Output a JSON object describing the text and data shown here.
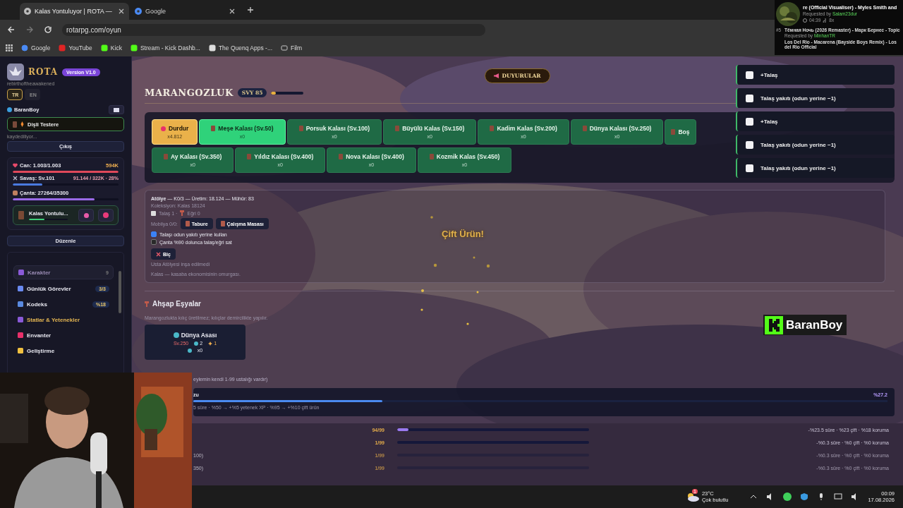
{
  "browser": {
    "tabs": [
      {
        "title": "Kalas Yontuluyor | ROTA —",
        "selected": true
      },
      {
        "title": "Google",
        "selected": false
      }
    ],
    "url": "rotarpg.com/oyun",
    "bookmarks": [
      "Google",
      "YouTube",
      "Kick",
      "Stream - Kick Dashb...",
      "The Quenq Apps -...",
      "Film"
    ]
  },
  "music_overlay": {
    "title": "re (Official Visualiser) - Myles Smith and",
    "requested_label": "Requested by",
    "requester": "Salam23dur",
    "duration": "04:39",
    "plays": "8x",
    "queue": [
      {
        "number": "#5",
        "title": "Тёмная Ночь (2026 Remaster) - Марк Бернес - Topic",
        "requested_label": "Requested by",
        "requester": "MinhanTR"
      },
      {
        "title": "Los Del Rio - Macarena (Bayside Boys Remix) - Los del Rio Official"
      }
    ]
  },
  "sidebar": {
    "logo": "ROTA",
    "version": "Version V1.0",
    "tagline": "rebirthoftheawakened",
    "languages": [
      {
        "label": "TR",
        "selected": true
      },
      {
        "label": "EN",
        "selected": false
      }
    ],
    "user": "BaranBoy",
    "equipped": "Dişli Testere",
    "save_status": "kaydediliyor...",
    "logout": "Çıkış",
    "stats": {
      "health": {
        "text": "Can: 1.003/1.003",
        "level": 1.0
      },
      "gold": "594K",
      "combat": {
        "text": "Savaş: Sv.101",
        "xp": "91.144 / 322K · 28%",
        "level": 0.28
      },
      "bag": {
        "text": "Çanta: 27264/35300",
        "level": 0.77
      }
    },
    "activity": {
      "label": "Kalas Yontulu...",
      "level": 0.4
    },
    "edit": "Düzenle",
    "menu": [
      {
        "label": "Karakter",
        "kind": "section",
        "count": "9",
        "selected": false
      },
      {
        "label": "Günlük Görevler",
        "kind": "item",
        "badge": "3/3",
        "selected": false
      },
      {
        "label": "Kodeks",
        "kind": "item",
        "badge": "%18",
        "selected": false
      },
      {
        "label": "Statlar & Yetenekler",
        "kind": "item",
        "selected": true
      },
      {
        "label": "Envanter",
        "kind": "item",
        "selected": false
      },
      {
        "label": "Geliştirme",
        "kind": "item",
        "selected": false
      }
    ]
  },
  "main": {
    "announcements": "DUYURULAR",
    "title": "MARANGOZLUK",
    "level": "SVY 85",
    "level_bar": {
      "level": 0.15
    },
    "recipe_rows": [
      [
        {
          "kind": "stop",
          "label": "Durdur",
          "count": "x4.812",
          "selected": false
        },
        {
          "kind": "recipe",
          "label": "Meşe Kalası (Sv.50)",
          "count": "x0",
          "selected": true
        },
        {
          "kind": "recipe",
          "label": "Porsuk Kalası (Sv.100)",
          "count": "x0",
          "selected": false
        },
        {
          "kind": "recipe",
          "label": "Büyülü Kalas (Sv.150)",
          "count": "x0",
          "selected": false
        },
        {
          "kind": "recipe",
          "label": "Kadim Kalas (Sv.200)",
          "count": "x0",
          "selected": false
        },
        {
          "kind": "recipe",
          "label": "Dünya Kalası (Sv.250)",
          "count": "x0",
          "selected": false
        },
        {
          "kind": "recipe",
          "label": "Boş",
          "selected": false
        }
      ],
      [
        {
          "kind": "recipe",
          "label": "Ay Kalası (Sv.350)",
          "count": "x0",
          "selected": false
        },
        {
          "kind": "recipe",
          "label": "Yıldız Kalası (Sv.400)",
          "count": "x0",
          "selected": false
        },
        {
          "kind": "recipe",
          "label": "Nova Kalası (Sv.400)",
          "count": "x0",
          "selected": false
        },
        {
          "kind": "recipe",
          "label": "Kozmik Kalas (Sv.450)",
          "count": "x0",
          "selected": false
        }
      ]
    ],
    "workshop": {
      "summary": "**Atölye** — K0/3 — Üretim: 18.124 — Mühür: 83",
      "collection": "Koleksiyon: Kalas 18124",
      "byproducts": [
        "Talaş 1 ·",
        "Eğri 0"
      ],
      "furniture_label": "Mobilya 0/0:",
      "furniture": [
        "Tabure",
        "Çalışma Masası"
      ],
      "options": [
        {
          "label": "Talaşı odun yakıtı yerine kullan",
          "checked": true
        },
        {
          "label": "Çanta %90 dolunca talaş/eğri sat",
          "checked": false
        }
      ],
      "action": "Biç",
      "note": "Usta Atölyesi inşa edilmedi",
      "footer": "Kalas — kasaba ekonomisinin omurgası.",
      "popup": "Çift Ürün!"
    },
    "wood_items": {
      "heading": "Ahşap Eşyalar",
      "note": "Marangozlukta kılıç üretilmez; kılıçlar demircilikte yapılır.",
      "items": [
        {
          "name": "Dünya Asası",
          "level": "Sv.250",
          "gems": "2",
          "stars": "1",
          "count": "x0"
        }
      ]
    },
    "mastery": {
      "note": "eylemin kendi 1-99 ustalığı vardır)",
      "current": {
        "label": "zu",
        "percent": "%27.2",
        "level": 0.272,
        "description": "5 süre · %50 → +%5 yetenek XP · %95 → +%10 çift ürün"
      },
      "rows": [
        {
          "progress": "94/99",
          "level": 0.06,
          "bonus": "-%23.5 süre · %23 çift · %18 koruma",
          "locked": false
        },
        {
          "progress": "1/99",
          "level": 0.0,
          "bonus": "-%0.3 süre · %0 çift · %0 koruma",
          "locked": false
        },
        {
          "name": "100)",
          "progress": "1/99",
          "level": 0.0,
          "bonus": "-%0.3 süre · %0 çift · %0 koruma",
          "locked": true
        },
        {
          "name": "350)",
          "progress": "1/99",
          "level": 0.0,
          "bonus": "-%0.3 süre · %0 çift · %0 koruma",
          "locked": true
        }
      ]
    }
  },
  "notifications": [
    "+Talaş",
    "Talaş yakıtı (odun yerine −1)",
    "+Talaş",
    "Talaş yakıtı (odun yerine −1)",
    "Talaş yakıtı (odun yerine −1)"
  ],
  "stream_overlay": {
    "name": "BaranBoy"
  },
  "taskbar": {
    "weather_badge": "1",
    "temperature": "23°C",
    "weather": "Çok bulutlu",
    "time": "00:09",
    "date": "17.08.2026"
  }
}
